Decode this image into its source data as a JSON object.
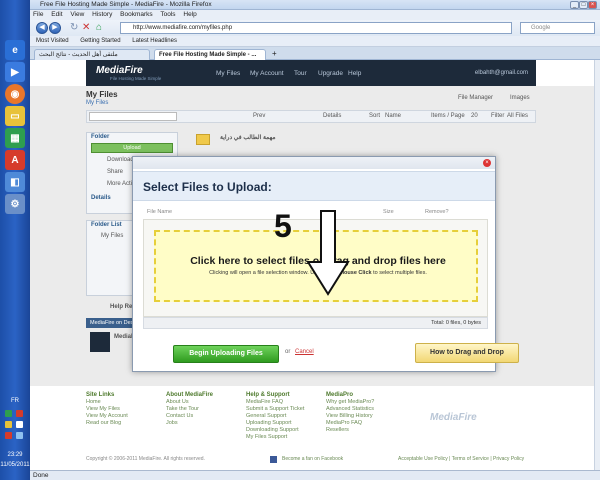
{
  "browser": {
    "title": "Free File Hosting Made Simple - MediaFire - Mozilla Firefox",
    "menu": [
      "File",
      "Edit",
      "View",
      "History",
      "Bookmarks",
      "Tools",
      "Help"
    ],
    "url": "http://www.mediafire.com/myfiles.php",
    "search_placeholder": "Google",
    "bookmarks": [
      "Most Visited",
      "Getting Started",
      "Latest Headlines"
    ],
    "tabs": [
      "ملتقى أهل الحديث - نتائج البحث",
      "Free File Hosting Made Simple - ..."
    ],
    "status": "Done"
  },
  "taskbar": {
    "lang": "FR",
    "time": "23:29",
    "date": "11/05/2011"
  },
  "mediafire": {
    "logo": "MediaFire",
    "tagline": "File Hosting Made Simple",
    "nav": [
      "My Files",
      "My Account",
      "Tour",
      "Upgrade",
      "Help"
    ],
    "email": "elbahth@gmail.com",
    "page_title": "My Files",
    "page_sub": "My Files",
    "file_manager": "File Manager",
    "images": "Images",
    "toolbar": {
      "prev": "Prev",
      "next": "Next",
      "details": "Details",
      "sort": "Sort",
      "sort_value": "Name",
      "items_page": "Items / Page",
      "items_value": "20",
      "filter": "Filter",
      "filter_value": "All Files"
    },
    "folder_name": "مهمة الطالب في دراية",
    "folder_header": "Folder",
    "upload": "Upload",
    "side_items": [
      "Download",
      "Share",
      "More Actions"
    ],
    "details": "Details",
    "folder_list": "Folder List",
    "my_files": "My Files",
    "help_label": "Help Res",
    "desktop_label": "MediaFire on Desktop",
    "desktop_product": "MediaFire"
  },
  "modal": {
    "title": "Select Files to Upload:",
    "col_file": "File Name",
    "col_size": "Size",
    "col_remove": "Remove?",
    "drop_title": "Click here to select files or drag and drop files here",
    "drop_sub_pre": "Clicking will open a file selection window. Use",
    "drop_sub_key": "CTRL+Mouse Click",
    "drop_sub_post": "to select multiple files.",
    "total": "Total: 0 files, 0 bytes",
    "begin": "Begin Uploading Files",
    "or": "or",
    "cancel": "Cancel",
    "howto": "How to Drag and Drop"
  },
  "annotation": {
    "number": "5"
  },
  "footer": {
    "cols": [
      {
        "head": "Site Links",
        "items": [
          "Home",
          "View My Files",
          "View My Account",
          "Read our Blog"
        ]
      },
      {
        "head": "About MediaFire",
        "items": [
          "About Us",
          "Take the Tour",
          "Contact Us",
          "Jobs"
        ]
      },
      {
        "head": "Help & Support",
        "items": [
          "MediaFire FAQ",
          "Submit a Support Ticket",
          "General Support",
          "Uploading Support",
          "Downloading Support",
          "My Files Support"
        ]
      },
      {
        "head": "MediaPro",
        "items": [
          "Why get MediaPro?",
          "Advanced Statistics",
          "View Billing History",
          "MediaPro FAQ",
          "Resellers"
        ]
      }
    ],
    "copyright": "Copyright © 2006-2011 MediaFire. All rights reserved.",
    "facebook": "Become a fan on Facebook",
    "legal": "Acceptable Use Policy | Terms of Service | Privacy Policy"
  }
}
